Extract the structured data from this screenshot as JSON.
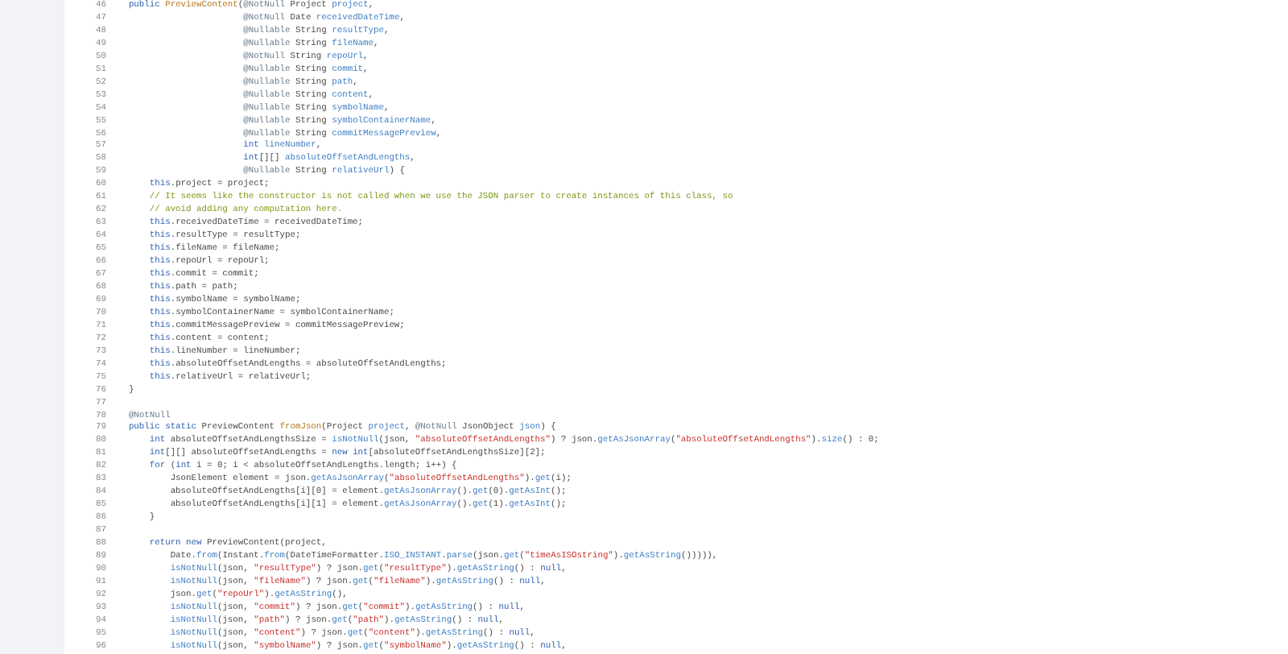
{
  "editor": {
    "lines": [
      {
        "number": "46",
        "tokens": [
          {
            "kind": "keyword",
            "text": "    public "
          },
          {
            "kind": "decl",
            "text": "PreviewContent"
          },
          {
            "kind": "plain",
            "text": "("
          },
          {
            "kind": "annotation",
            "text": "@NotNull"
          },
          {
            "kind": "plain",
            "text": " Project "
          },
          {
            "kind": "name",
            "text": "project"
          },
          {
            "kind": "plain",
            "text": ","
          }
        ]
      },
      {
        "number": "47",
        "tokens": [
          {
            "kind": "annotation",
            "text": "                          @NotNull"
          },
          {
            "kind": "plain",
            "text": " Date "
          },
          {
            "kind": "name",
            "text": "receivedDateTime"
          },
          {
            "kind": "plain",
            "text": ","
          }
        ]
      },
      {
        "number": "48",
        "tokens": [
          {
            "kind": "annotation",
            "text": "                          @Nullable"
          },
          {
            "kind": "plain",
            "text": " String "
          },
          {
            "kind": "name",
            "text": "resultType"
          },
          {
            "kind": "plain",
            "text": ","
          }
        ]
      },
      {
        "number": "49",
        "tokens": [
          {
            "kind": "annotation",
            "text": "                          @Nullable"
          },
          {
            "kind": "plain",
            "text": " String "
          },
          {
            "kind": "name",
            "text": "fileName"
          },
          {
            "kind": "plain",
            "text": ","
          }
        ]
      },
      {
        "number": "50",
        "tokens": [
          {
            "kind": "annotation",
            "text": "                          @NotNull"
          },
          {
            "kind": "plain",
            "text": " String "
          },
          {
            "kind": "name",
            "text": "repoUrl"
          },
          {
            "kind": "plain",
            "text": ","
          }
        ]
      },
      {
        "number": "51",
        "tokens": [
          {
            "kind": "annotation",
            "text": "                          @Nullable"
          },
          {
            "kind": "plain",
            "text": " String "
          },
          {
            "kind": "name",
            "text": "commit"
          },
          {
            "kind": "plain",
            "text": ","
          }
        ]
      },
      {
        "number": "52",
        "tokens": [
          {
            "kind": "annotation",
            "text": "                          @Nullable"
          },
          {
            "kind": "plain",
            "text": " String "
          },
          {
            "kind": "name",
            "text": "path"
          },
          {
            "kind": "plain",
            "text": ","
          }
        ]
      },
      {
        "number": "53",
        "tokens": [
          {
            "kind": "annotation",
            "text": "                          @Nullable"
          },
          {
            "kind": "plain",
            "text": " String "
          },
          {
            "kind": "name",
            "text": "content"
          },
          {
            "kind": "plain",
            "text": ","
          }
        ]
      },
      {
        "number": "54",
        "tokens": [
          {
            "kind": "annotation",
            "text": "                          @Nullable"
          },
          {
            "kind": "plain",
            "text": " String "
          },
          {
            "kind": "name",
            "text": "symbolName"
          },
          {
            "kind": "plain",
            "text": ","
          }
        ]
      },
      {
        "number": "55",
        "tokens": [
          {
            "kind": "annotation",
            "text": "                          @Nullable"
          },
          {
            "kind": "plain",
            "text": " String "
          },
          {
            "kind": "name",
            "text": "symbolContainerName"
          },
          {
            "kind": "plain",
            "text": ","
          }
        ]
      },
      {
        "number": "56",
        "tokens": [
          {
            "kind": "annotation",
            "text": "                          @Nullable"
          },
          {
            "kind": "plain",
            "text": " String "
          },
          {
            "kind": "name",
            "text": "commitMessagePreview"
          },
          {
            "kind": "plain",
            "text": ","
          }
        ]
      },
      {
        "number": "57",
        "tokens": [
          {
            "kind": "keyword",
            "text": "                          int"
          },
          {
            "kind": "name",
            "text": " lineNumber"
          },
          {
            "kind": "plain",
            "text": ","
          }
        ]
      },
      {
        "number": "58",
        "tokens": [
          {
            "kind": "keyword",
            "text": "                          int"
          },
          {
            "kind": "plain",
            "text": "[][]"
          },
          {
            "kind": "name",
            "text": " absoluteOffsetAndLengths"
          },
          {
            "kind": "plain",
            "text": ","
          }
        ]
      },
      {
        "number": "59",
        "tokens": [
          {
            "kind": "annotation",
            "text": "                          @Nullable"
          },
          {
            "kind": "plain",
            "text": " String "
          },
          {
            "kind": "name",
            "text": "relativeUrl"
          },
          {
            "kind": "plain",
            "text": ") {"
          }
        ]
      },
      {
        "number": "60",
        "tokens": [
          {
            "kind": "keyword",
            "text": "        this"
          },
          {
            "kind": "plain",
            "text": ".project = project;"
          }
        ]
      },
      {
        "number": "61",
        "tokens": [
          {
            "kind": "comment",
            "text": "        // It seems like the constructor is not called when we use the JSON parser to create instances of this class, so"
          }
        ]
      },
      {
        "number": "62",
        "tokens": [
          {
            "kind": "comment",
            "text": "        // avoid adding any computation here."
          }
        ]
      },
      {
        "number": "63",
        "tokens": [
          {
            "kind": "keyword",
            "text": "        this"
          },
          {
            "kind": "plain",
            "text": ".receivedDateTime = receivedDateTime;"
          }
        ]
      },
      {
        "number": "64",
        "tokens": [
          {
            "kind": "keyword",
            "text": "        this"
          },
          {
            "kind": "plain",
            "text": ".resultType = resultType;"
          }
        ]
      },
      {
        "number": "65",
        "tokens": [
          {
            "kind": "keyword",
            "text": "        this"
          },
          {
            "kind": "plain",
            "text": ".fileName = fileName;"
          }
        ]
      },
      {
        "number": "66",
        "tokens": [
          {
            "kind": "keyword",
            "text": "        this"
          },
          {
            "kind": "plain",
            "text": ".repoUrl = repoUrl;"
          }
        ]
      },
      {
        "number": "67",
        "tokens": [
          {
            "kind": "keyword",
            "text": "        this"
          },
          {
            "kind": "plain",
            "text": ".commit = commit;"
          }
        ]
      },
      {
        "number": "68",
        "tokens": [
          {
            "kind": "keyword",
            "text": "        this"
          },
          {
            "kind": "plain",
            "text": ".path = path;"
          }
        ]
      },
      {
        "number": "69",
        "tokens": [
          {
            "kind": "keyword",
            "text": "        this"
          },
          {
            "kind": "plain",
            "text": ".symbolName = symbolName;"
          }
        ]
      },
      {
        "number": "70",
        "tokens": [
          {
            "kind": "keyword",
            "text": "        this"
          },
          {
            "kind": "plain",
            "text": ".symbolContainerName = symbolContainerName;"
          }
        ]
      },
      {
        "number": "71",
        "tokens": [
          {
            "kind": "keyword",
            "text": "        this"
          },
          {
            "kind": "plain",
            "text": ".commitMessagePreview = commitMessagePreview;"
          }
        ]
      },
      {
        "number": "72",
        "tokens": [
          {
            "kind": "keyword",
            "text": "        this"
          },
          {
            "kind": "plain",
            "text": ".content = content;"
          }
        ]
      },
      {
        "number": "73",
        "tokens": [
          {
            "kind": "keyword",
            "text": "        this"
          },
          {
            "kind": "plain",
            "text": ".lineNumber = lineNumber;"
          }
        ]
      },
      {
        "number": "74",
        "tokens": [
          {
            "kind": "keyword",
            "text": "        this"
          },
          {
            "kind": "plain",
            "text": ".absoluteOffsetAndLengths = absoluteOffsetAndLengths;"
          }
        ]
      },
      {
        "number": "75",
        "tokens": [
          {
            "kind": "keyword",
            "text": "        this"
          },
          {
            "kind": "plain",
            "text": ".relativeUrl = relativeUrl;"
          }
        ]
      },
      {
        "number": "76",
        "tokens": [
          {
            "kind": "plain",
            "text": "    }"
          }
        ]
      },
      {
        "number": "77"
      },
      {
        "number": "78",
        "tokens": [
          {
            "kind": "annotation",
            "text": "    @NotNull"
          }
        ]
      },
      {
        "number": "79",
        "tokens": [
          {
            "kind": "keyword",
            "text": "    public static "
          },
          {
            "kind": "plain",
            "text": "PreviewContent "
          },
          {
            "kind": "decl",
            "text": "fromJson"
          },
          {
            "kind": "plain",
            "text": "(Project "
          },
          {
            "kind": "name",
            "text": "project"
          },
          {
            "kind": "plain",
            "text": ", "
          },
          {
            "kind": "annotation",
            "text": "@NotNull"
          },
          {
            "kind": "plain",
            "text": " JsonObject "
          },
          {
            "kind": "name",
            "text": "json"
          },
          {
            "kind": "plain",
            "text": ") {"
          }
        ]
      },
      {
        "number": "80",
        "tokens": [
          {
            "kind": "keyword",
            "text": "        int"
          },
          {
            "kind": "plain",
            "text": " absoluteOffsetAndLengthsSize = "
          },
          {
            "kind": "name",
            "text": "isNotNull"
          },
          {
            "kind": "plain",
            "text": "(json, "
          },
          {
            "kind": "string",
            "text": "\"absoluteOffsetAndLengths\""
          },
          {
            "kind": "plain",
            "text": ") ? json."
          },
          {
            "kind": "name",
            "text": "getAsJsonArray"
          },
          {
            "kind": "plain",
            "text": "("
          },
          {
            "kind": "string",
            "text": "\"absoluteOffsetAndLengths\""
          },
          {
            "kind": "plain",
            "text": ")."
          },
          {
            "kind": "name",
            "text": "size"
          },
          {
            "kind": "plain",
            "text": "() : 0;"
          }
        ]
      },
      {
        "number": "81",
        "tokens": [
          {
            "kind": "keyword",
            "text": "        int"
          },
          {
            "kind": "plain",
            "text": "[][] absoluteOffsetAndLengths = "
          },
          {
            "kind": "keyword",
            "text": "new int"
          },
          {
            "kind": "plain",
            "text": "[absoluteOffsetAndLengthsSize][2];"
          }
        ]
      },
      {
        "number": "82",
        "tokens": [
          {
            "kind": "keyword",
            "text": "        for"
          },
          {
            "kind": "plain",
            "text": " ("
          },
          {
            "kind": "keyword",
            "text": "int"
          },
          {
            "kind": "plain",
            "text": " i = 0; i < absoluteOffsetAndLengths.length; i++) {"
          }
        ]
      },
      {
        "number": "83",
        "tokens": [
          {
            "kind": "plain",
            "text": "            JsonElement element = json."
          },
          {
            "kind": "name",
            "text": "getAsJsonArray"
          },
          {
            "kind": "plain",
            "text": "("
          },
          {
            "kind": "string",
            "text": "\"absoluteOffsetAndLengths\""
          },
          {
            "kind": "plain",
            "text": ")."
          },
          {
            "kind": "name",
            "text": "get"
          },
          {
            "kind": "plain",
            "text": "(i);"
          }
        ]
      },
      {
        "number": "84",
        "tokens": [
          {
            "kind": "plain",
            "text": "            absoluteOffsetAndLengths[i][0] = element."
          },
          {
            "kind": "name",
            "text": "getAsJsonArray"
          },
          {
            "kind": "plain",
            "text": "()."
          },
          {
            "kind": "name",
            "text": "get"
          },
          {
            "kind": "plain",
            "text": "(0)."
          },
          {
            "kind": "name",
            "text": "getAsInt"
          },
          {
            "kind": "plain",
            "text": "();"
          }
        ]
      },
      {
        "number": "85",
        "tokens": [
          {
            "kind": "plain",
            "text": "            absoluteOffsetAndLengths[i][1] = element."
          },
          {
            "kind": "name",
            "text": "getAsJsonArray"
          },
          {
            "kind": "plain",
            "text": "()."
          },
          {
            "kind": "name",
            "text": "get"
          },
          {
            "kind": "plain",
            "text": "(1)."
          },
          {
            "kind": "name",
            "text": "getAsInt"
          },
          {
            "kind": "plain",
            "text": "();"
          }
        ]
      },
      {
        "number": "86",
        "tokens": [
          {
            "kind": "plain",
            "text": "        }"
          }
        ]
      },
      {
        "number": "87"
      },
      {
        "number": "88",
        "tokens": [
          {
            "kind": "keyword",
            "text": "        return new "
          },
          {
            "kind": "plain",
            "text": "PreviewContent(project,"
          }
        ]
      },
      {
        "number": "89",
        "tokens": [
          {
            "kind": "plain",
            "text": "            Date."
          },
          {
            "kind": "name",
            "text": "from"
          },
          {
            "kind": "plain",
            "text": "(Instant."
          },
          {
            "kind": "name",
            "text": "from"
          },
          {
            "kind": "plain",
            "text": "(DateTimeFormatter."
          },
          {
            "kind": "name",
            "text": "ISO_INSTANT"
          },
          {
            "kind": "plain",
            "text": "."
          },
          {
            "kind": "name",
            "text": "parse"
          },
          {
            "kind": "plain",
            "text": "(json."
          },
          {
            "kind": "name",
            "text": "get"
          },
          {
            "kind": "plain",
            "text": "("
          },
          {
            "kind": "string",
            "text": "\"timeAsISOstring\""
          },
          {
            "kind": "plain",
            "text": ")."
          },
          {
            "kind": "name",
            "text": "getAsString"
          },
          {
            "kind": "plain",
            "text": "())))),"
          }
        ]
      },
      {
        "number": "90",
        "tokens": [
          {
            "kind": "name",
            "text": "            isNotNull"
          },
          {
            "kind": "plain",
            "text": "(json, "
          },
          {
            "kind": "string",
            "text": "\"resultType\""
          },
          {
            "kind": "plain",
            "text": ") ? json."
          },
          {
            "kind": "name",
            "text": "get"
          },
          {
            "kind": "plain",
            "text": "("
          },
          {
            "kind": "string",
            "text": "\"resultType\""
          },
          {
            "kind": "plain",
            "text": ")."
          },
          {
            "kind": "name",
            "text": "getAsString"
          },
          {
            "kind": "plain",
            "text": "() : "
          },
          {
            "kind": "keyword",
            "text": "null"
          },
          {
            "kind": "plain",
            "text": ","
          }
        ]
      },
      {
        "number": "91",
        "tokens": [
          {
            "kind": "name",
            "text": "            isNotNull"
          },
          {
            "kind": "plain",
            "text": "(json, "
          },
          {
            "kind": "string",
            "text": "\"fileName\""
          },
          {
            "kind": "plain",
            "text": ") ? json."
          },
          {
            "kind": "name",
            "text": "get"
          },
          {
            "kind": "plain",
            "text": "("
          },
          {
            "kind": "string",
            "text": "\"fileName\""
          },
          {
            "kind": "plain",
            "text": ")."
          },
          {
            "kind": "name",
            "text": "getAsString"
          },
          {
            "kind": "plain",
            "text": "() : "
          },
          {
            "kind": "keyword",
            "text": "null"
          },
          {
            "kind": "plain",
            "text": ","
          }
        ]
      },
      {
        "number": "92",
        "tokens": [
          {
            "kind": "plain",
            "text": "            json."
          },
          {
            "kind": "name",
            "text": "get"
          },
          {
            "kind": "plain",
            "text": "("
          },
          {
            "kind": "string",
            "text": "\"repoUrl\""
          },
          {
            "kind": "plain",
            "text": ")."
          },
          {
            "kind": "name",
            "text": "getAsString"
          },
          {
            "kind": "plain",
            "text": "(),"
          }
        ]
      },
      {
        "number": "93",
        "tokens": [
          {
            "kind": "name",
            "text": "            isNotNull"
          },
          {
            "kind": "plain",
            "text": "(json, "
          },
          {
            "kind": "string",
            "text": "\"commit\""
          },
          {
            "kind": "plain",
            "text": ") ? json."
          },
          {
            "kind": "name",
            "text": "get"
          },
          {
            "kind": "plain",
            "text": "("
          },
          {
            "kind": "string",
            "text": "\"commit\""
          },
          {
            "kind": "plain",
            "text": ")."
          },
          {
            "kind": "name",
            "text": "getAsString"
          },
          {
            "kind": "plain",
            "text": "() : "
          },
          {
            "kind": "keyword",
            "text": "null"
          },
          {
            "kind": "plain",
            "text": ","
          }
        ]
      },
      {
        "number": "94",
        "tokens": [
          {
            "kind": "name",
            "text": "            isNotNull"
          },
          {
            "kind": "plain",
            "text": "(json, "
          },
          {
            "kind": "string",
            "text": "\"path\""
          },
          {
            "kind": "plain",
            "text": ") ? json."
          },
          {
            "kind": "name",
            "text": "get"
          },
          {
            "kind": "plain",
            "text": "("
          },
          {
            "kind": "string",
            "text": "\"path\""
          },
          {
            "kind": "plain",
            "text": ")."
          },
          {
            "kind": "name",
            "text": "getAsString"
          },
          {
            "kind": "plain",
            "text": "() : "
          },
          {
            "kind": "keyword",
            "text": "null"
          },
          {
            "kind": "plain",
            "text": ","
          }
        ]
      },
      {
        "number": "95",
        "tokens": [
          {
            "kind": "name",
            "text": "            isNotNull"
          },
          {
            "kind": "plain",
            "text": "(json, "
          },
          {
            "kind": "string",
            "text": "\"content\""
          },
          {
            "kind": "plain",
            "text": ") ? json."
          },
          {
            "kind": "name",
            "text": "get"
          },
          {
            "kind": "plain",
            "text": "("
          },
          {
            "kind": "string",
            "text": "\"content\""
          },
          {
            "kind": "plain",
            "text": ")."
          },
          {
            "kind": "name",
            "text": "getAsString"
          },
          {
            "kind": "plain",
            "text": "() : "
          },
          {
            "kind": "keyword",
            "text": "null"
          },
          {
            "kind": "plain",
            "text": ","
          }
        ]
      },
      {
        "number": "96",
        "tokens": [
          {
            "kind": "name",
            "text": "            isNotNull"
          },
          {
            "kind": "plain",
            "text": "(json, "
          },
          {
            "kind": "string",
            "text": "\"symbolName\""
          },
          {
            "kind": "plain",
            "text": ") ? json."
          },
          {
            "kind": "name",
            "text": "get"
          },
          {
            "kind": "plain",
            "text": "("
          },
          {
            "kind": "string",
            "text": "\"symbolName\""
          },
          {
            "kind": "plain",
            "text": ")."
          },
          {
            "kind": "name",
            "text": "getAsString"
          },
          {
            "kind": "plain",
            "text": "() : "
          },
          {
            "kind": "keyword",
            "text": "null"
          },
          {
            "kind": "plain",
            "text": ","
          }
        ]
      }
    ]
  }
}
